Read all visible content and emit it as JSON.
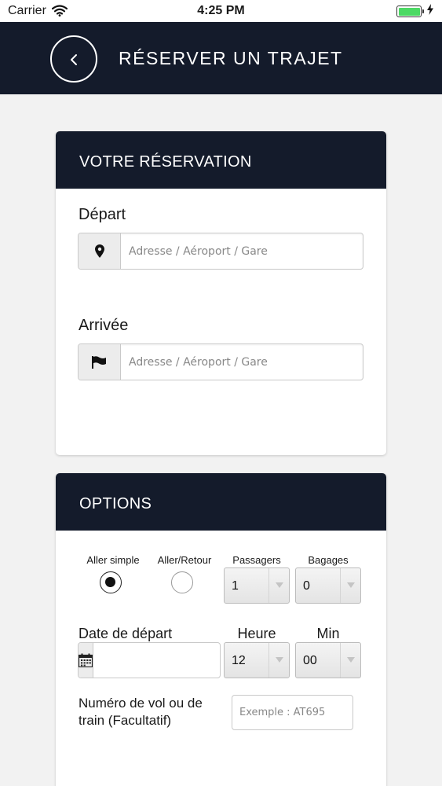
{
  "status_bar": {
    "carrier": "Carrier",
    "time": "4:25 PM"
  },
  "nav": {
    "title": "RÉSERVER UN TRAJET",
    "back_icon": "chevron-left-icon"
  },
  "reservation": {
    "header": "VOTRE RÉSERVATION",
    "departure": {
      "label": "Départ",
      "placeholder": "Adresse / Aéroport / Gare",
      "value": "",
      "icon": "map-marker-icon"
    },
    "arrival": {
      "label": "Arrivée",
      "placeholder": "Adresse / Aéroport / Gare",
      "value": "",
      "icon": "flag-icon"
    }
  },
  "options": {
    "header": "OPTIONS",
    "one_way_label": "Aller simple",
    "round_trip_label": "Aller/Retour",
    "trip_type_selected": "Aller simple",
    "passengers_label": "Passagers",
    "passengers_value": "1",
    "luggage_label": "Bagages",
    "luggage_value": "0",
    "date_label": "Date de départ",
    "date_value": "",
    "date_icon": "calendar-icon",
    "hour_label": "Heure",
    "hour_value": "12",
    "minute_label": "Min",
    "minute_value": "00",
    "flight_label": "Numéro de vol ou de train (Facultatif)",
    "flight_placeholder": "Exemple : AT695",
    "flight_value": ""
  },
  "colors": {
    "header_bg": "#141b2b",
    "page_bg": "#f2f2f2",
    "battery": "#4cd964"
  }
}
